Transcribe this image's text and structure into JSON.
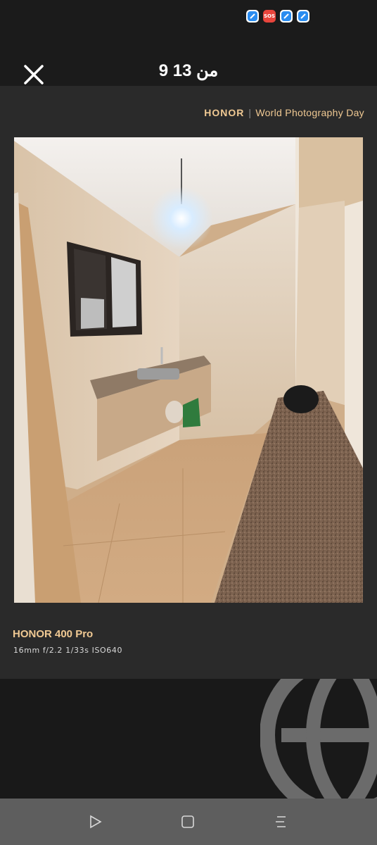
{
  "status_bar": {
    "icons": [
      "app-icon",
      "sos-icon",
      "app-icon",
      "app-icon"
    ],
    "sos_label": "SOS"
  },
  "header": {
    "counter": "9 من 13",
    "close_icon": "close-icon"
  },
  "photo": {
    "watermark_brand": "HONOR",
    "watermark_separator": "|",
    "watermark_text": "World Photography Day",
    "camera_model": "HONOR 400 Pro",
    "camera_params": "16mm  f/2.2  1/33s  ISO640",
    "description_icon": "room-photo"
  },
  "nav_bar": {
    "back_icon": "triangle-back-icon",
    "home_icon": "square-home-icon",
    "menu_icon": "menu-lines-icon"
  },
  "colors": {
    "accent": "#f0c993",
    "background": "#1b1b1b",
    "card": "#2a2a2a",
    "nav": "#5e5e5e"
  }
}
